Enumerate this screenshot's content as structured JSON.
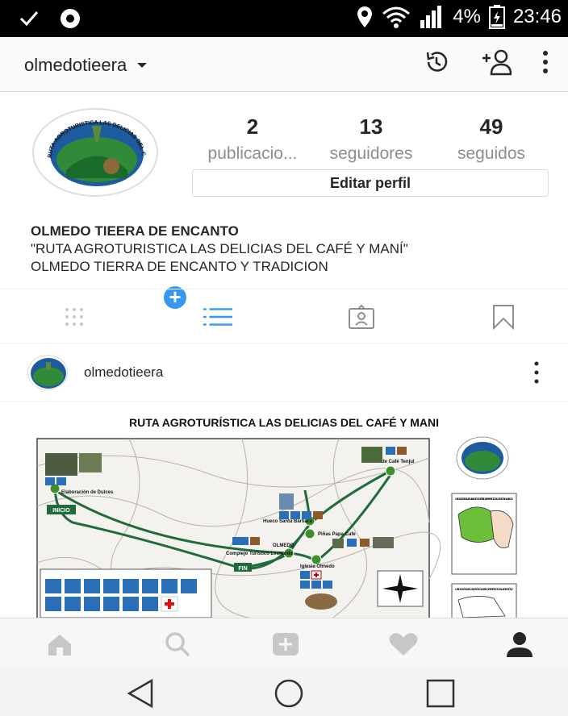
{
  "status_bar": {
    "battery": "4%",
    "time": "23:46",
    "icons": [
      "check-icon",
      "settings-circle-icon",
      "location-icon",
      "wifi-icon",
      "signal-icon",
      "battery-icon"
    ]
  },
  "header": {
    "username": "olmedotieera",
    "icons": [
      "history-icon",
      "add-person-icon",
      "more-vert-icon"
    ]
  },
  "profile": {
    "stats": [
      {
        "count": "2",
        "label": "publicacio..."
      },
      {
        "count": "13",
        "label": "seguidores"
      },
      {
        "count": "49",
        "label": "seguidos"
      }
    ],
    "edit_label": "Editar perfil",
    "bio_name": "OLMEDO TIEERA DE ENCANTO",
    "bio_line1": "\"RUTA AGROTURISTICA LAS DELICIAS DEL CAFÉ Y MANÍ\"",
    "bio_line2": "OLMEDO TIERRA DE ENCANTO Y TRADICION",
    "avatar_text": "RUTA AGROTURISTICA LAS DELICIAS DEL CAFÉ Y MANÍ"
  },
  "tabs": [
    "grid-icon",
    "list-icon",
    "tagged-icon",
    "bookmark-icon"
  ],
  "post": {
    "username": "olmedotieera",
    "image_title": "RUTA AGROTURÍSTICA LAS DELICIAS DEL CAFÉ Y MANI",
    "map_labels": {
      "start": "INICIO",
      "end": "FIN",
      "town": "OLMEDO",
      "place1": "Elaboración de Dulces",
      "place2": "Hueco Santa Bárbara",
      "place3": "Piñas Papa Cafe",
      "place4": "Huerto de Café Tenjul",
      "place5": "Complejo Turístico Leonardo",
      "place6": "Iglesia Olmedo"
    },
    "side_labels": {
      "box1_title": "UBICACIÓN DE LA RUTA AGROTURÍSTICA RESPECTO AL CANTÓN OLMEDO",
      "box2_title": "UBICACIÓN DEL CANTÓN OLMEDO RESPECTO A LA REGIÓN 7"
    }
  },
  "bottom_nav": [
    "home-icon",
    "search-icon",
    "add-post-icon",
    "heart-icon",
    "profile-icon"
  ],
  "system_nav": [
    "back-icon",
    "home-circle-icon",
    "recents-icon"
  ]
}
